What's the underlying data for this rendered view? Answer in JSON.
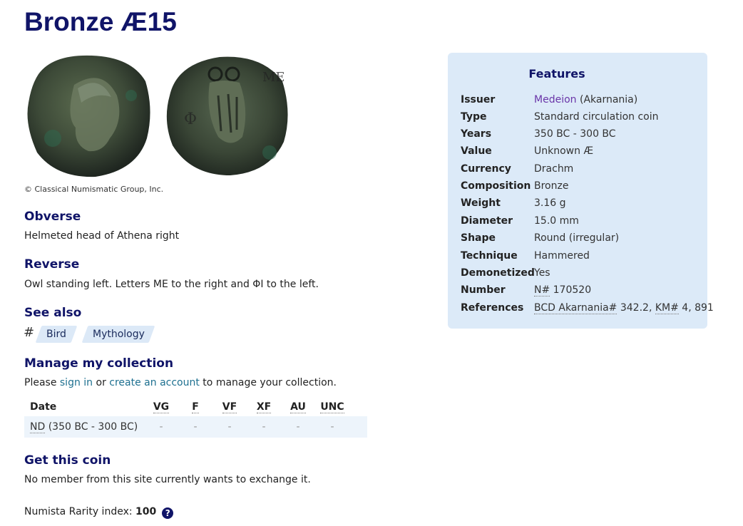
{
  "page": {
    "title": "Bronze Æ15",
    "copyright": "© Classical Numismatic Group, Inc."
  },
  "obverse": {
    "heading": "Obverse",
    "text": "Helmeted head of Athena right"
  },
  "reverse": {
    "heading": "Reverse",
    "text": "Owl standing left. Letters ΜΕ to the right and ΦΙ to the left."
  },
  "see_also": {
    "heading": "See also",
    "hash": "#",
    "tags": [
      "Bird",
      "Mythology"
    ]
  },
  "manage": {
    "heading": "Manage my collection",
    "text_before": "Please ",
    "sign_in": "sign in",
    "text_middle": " or ",
    "create_account": "create an account",
    "text_after": " to manage your collection."
  },
  "grade_table": {
    "headers": [
      "Date",
      "VG",
      "F",
      "VF",
      "XF",
      "AU",
      "UNC"
    ],
    "row": {
      "nd": "ND",
      "date": " (350 BC - 300 BC)",
      "cells": [
        "-",
        "-",
        "-",
        "-",
        "-",
        "-"
      ]
    }
  },
  "get_coin": {
    "heading": "Get this coin",
    "text": "No member from this site currently wants to exchange it."
  },
  "rarity": {
    "label": "Numista Rarity index: ",
    "value": "100",
    "help": "?"
  },
  "features": {
    "heading": "Features",
    "rows": [
      {
        "key": "Issuer",
        "link": "Medeion",
        "value": " (Akarnania)"
      },
      {
        "key": "Type",
        "value": "Standard circulation coin"
      },
      {
        "key": "Years",
        "value": "350 BC - 300 BC"
      },
      {
        "key": "Value",
        "value": "Unknown Æ"
      },
      {
        "key": "Currency",
        "value": "Drachm"
      },
      {
        "key": "Composition",
        "value": "Bronze"
      },
      {
        "key": "Weight",
        "value": "3.16 g"
      },
      {
        "key": "Diameter",
        "value": "15.0 mm"
      },
      {
        "key": "Shape",
        "value": "Round (irregular)"
      },
      {
        "key": "Technique",
        "value": "Hammered"
      },
      {
        "key": "Demonetized",
        "value": "Yes"
      },
      {
        "key": "Number",
        "prefix": "N#",
        "value": " 170520"
      },
      {
        "key": "References",
        "ref1": "BCD Akarnania#",
        "ref1_val": " 342.2, ",
        "ref2": "KM#",
        "ref2_val": " 4, 891"
      }
    ]
  },
  "colors": {
    "heading": "#101468",
    "panel": "#dceaf8",
    "link": "#1e7090",
    "issuer_link": "#6a35a8"
  }
}
